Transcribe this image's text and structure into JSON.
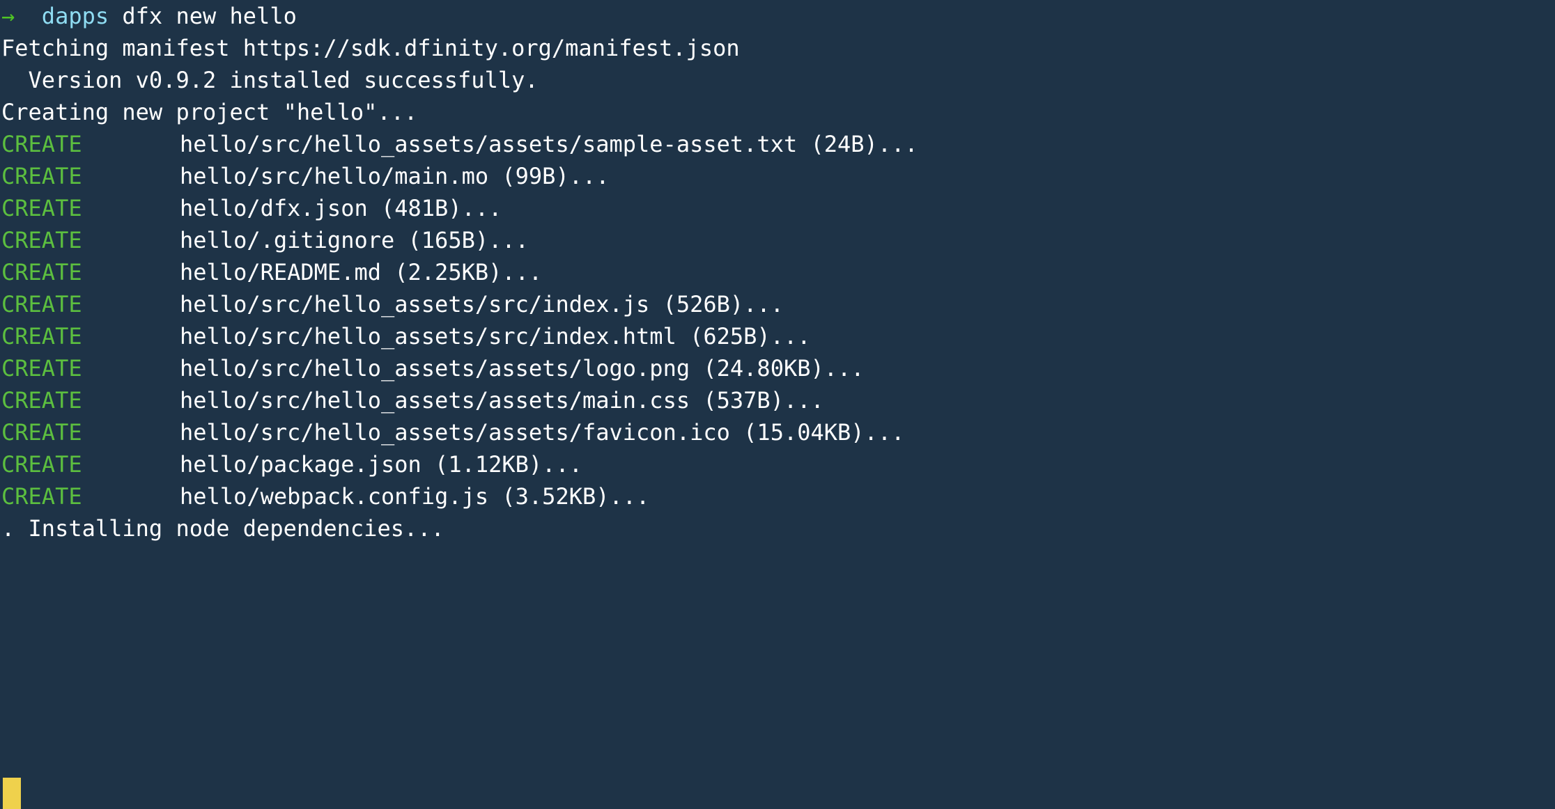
{
  "terminal": {
    "background_color": "#1e3347",
    "foreground_color": "#ffffff",
    "create_color": "#5cbf3f",
    "prompt_arrow_color": "#4fc424",
    "prompt_dir_color": "#8fdcf2",
    "cursor_color": "#efd14c"
  },
  "prompt": {
    "arrow": "→",
    "gap": "  ",
    "directory": "dapps",
    "command": " dfx new hello"
  },
  "output": {
    "fetching_line": "Fetching manifest https://sdk.dfinity.org/manifest.json",
    "version_line": "  Version v0.9.2 installed successfully.",
    "creating_line": "Creating new project \"hello\"...",
    "installing_line": ". Installing node dependencies..."
  },
  "create_label": "CREATE",
  "created_files": [
    {
      "tag": "CREATE",
      "path": "hello/src/hello_assets/assets/sample-asset.txt",
      "size": "24B",
      "suffix": "..."
    },
    {
      "tag": "CREATE",
      "path": "hello/src/hello/main.mo",
      "size": "99B",
      "suffix": "..."
    },
    {
      "tag": "CREATE",
      "path": "hello/dfx.json",
      "size": "481B",
      "suffix": "..."
    },
    {
      "tag": "CREATE",
      "path": "hello/.gitignore",
      "size": "165B",
      "suffix": "..."
    },
    {
      "tag": "CREATE",
      "path": "hello/README.md",
      "size": "2.25KB",
      "suffix": "..."
    },
    {
      "tag": "CREATE",
      "path": "hello/src/hello_assets/src/index.js",
      "size": "526B",
      "suffix": "..."
    },
    {
      "tag": "CREATE",
      "path": "hello/src/hello_assets/src/index.html",
      "size": "625B",
      "suffix": "..."
    },
    {
      "tag": "CREATE",
      "path": "hello/src/hello_assets/assets/logo.png",
      "size": "24.80KB",
      "suffix": "..."
    },
    {
      "tag": "CREATE",
      "path": "hello/src/hello_assets/assets/main.css",
      "size": "537B",
      "suffix": "..."
    },
    {
      "tag": "CREATE",
      "path": "hello/src/hello_assets/assets/favicon.ico",
      "size": "15.04KB",
      "suffix": "..."
    },
    {
      "tag": "CREATE",
      "path": "hello/package.json",
      "size": "1.12KB",
      "suffix": "..."
    },
    {
      "tag": "CREATE",
      "path": "hello/webpack.config.js",
      "size": "3.52KB",
      "suffix": "..."
    }
  ],
  "create_rows": [
    {
      "tag": "CREATE",
      "line": "hello/src/hello_assets/assets/sample-asset.txt (24B)..."
    },
    {
      "tag": "CREATE",
      "line": "hello/src/hello/main.mo (99B)..."
    },
    {
      "tag": "CREATE",
      "line": "hello/dfx.json (481B)..."
    },
    {
      "tag": "CREATE",
      "line": "hello/.gitignore (165B)..."
    },
    {
      "tag": "CREATE",
      "line": "hello/README.md (2.25KB)..."
    },
    {
      "tag": "CREATE",
      "line": "hello/src/hello_assets/src/index.js (526B)..."
    },
    {
      "tag": "CREATE",
      "line": "hello/src/hello_assets/src/index.html (625B)..."
    },
    {
      "tag": "CREATE",
      "line": "hello/src/hello_assets/assets/logo.png (24.80KB)..."
    },
    {
      "tag": "CREATE",
      "line": "hello/src/hello_assets/assets/main.css (537B)..."
    },
    {
      "tag": "CREATE",
      "line": "hello/src/hello_assets/assets/favicon.ico (15.04KB)..."
    },
    {
      "tag": "CREATE",
      "line": "hello/package.json (1.12KB)..."
    },
    {
      "tag": "CREATE",
      "line": "hello/webpack.config.js (3.52KB)..."
    }
  ]
}
